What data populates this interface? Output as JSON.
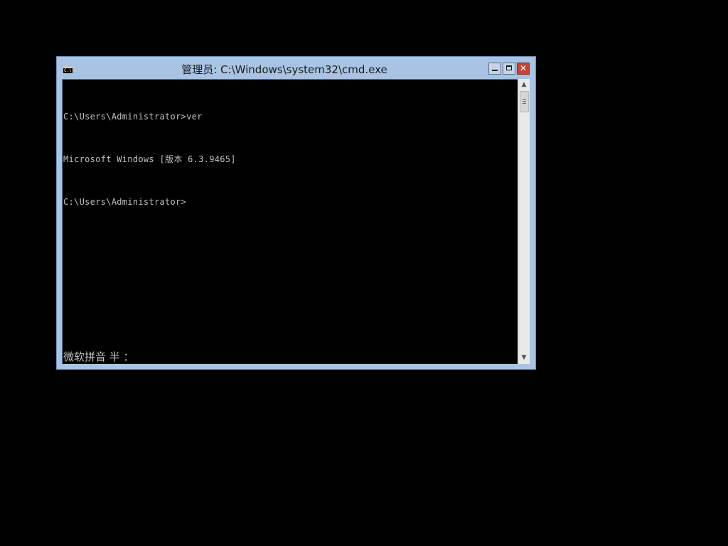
{
  "desktop": {
    "background": "#000000"
  },
  "window": {
    "title": "管理员: C:\\Windows\\system32\\cmd.exe",
    "app_icon": {
      "name": "cmd-icon",
      "glyph": "C:\\"
    },
    "frame_color": "#a9c4e3",
    "controls": {
      "minimize": "minimize-icon",
      "maximize": "maximize-icon",
      "close": "close-icon",
      "close_color": "#c74536"
    }
  },
  "console": {
    "text_color": "#c0c0c0",
    "background": "#000000",
    "lines": [
      "C:\\Users\\Administrator>ver",
      "Microsoft Windows [版本 6.3.9465]",
      "C:\\Users\\Administrator>"
    ],
    "ime_status": "微软拼音 半 ："
  },
  "scrollbar": {
    "up_icon": "chevron-up-icon",
    "down_icon": "chevron-down-icon",
    "thumb": "scroll-thumb"
  }
}
